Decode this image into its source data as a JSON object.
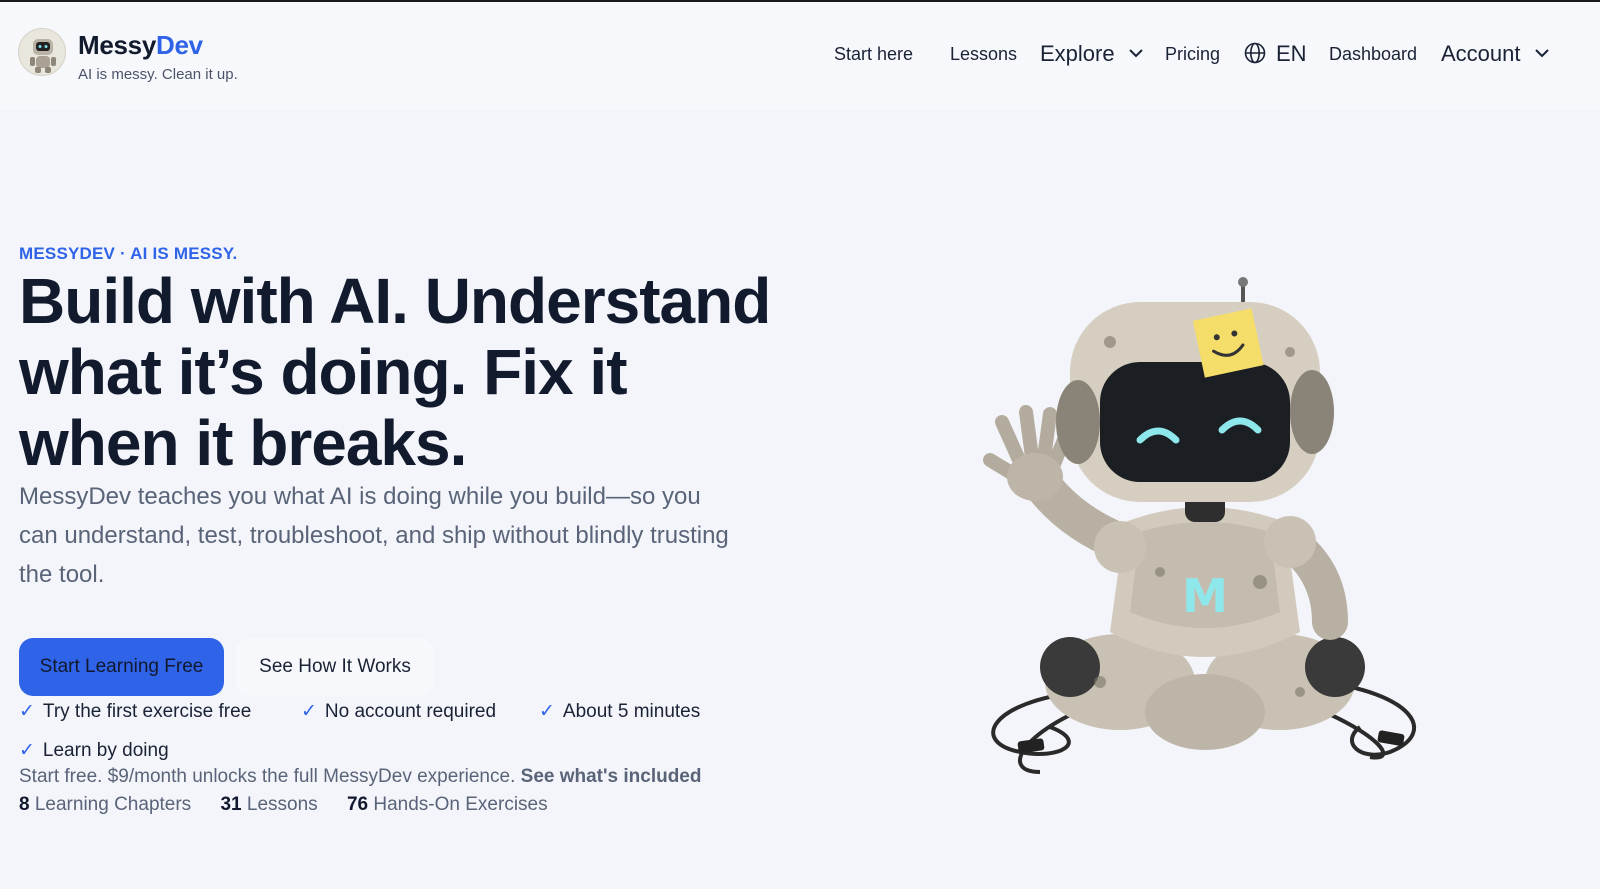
{
  "header": {
    "brand_part1": "Messy",
    "brand_part2": "Dev",
    "tagline": "AI is messy. Clean it up."
  },
  "nav": {
    "start_here": "Start here",
    "lessons": "Lessons",
    "explore": "Explore",
    "pricing": "Pricing",
    "language": "EN",
    "dashboard": "Dashboard",
    "account": "Account"
  },
  "hero": {
    "eyebrow": "MESSYDEV · AI IS MESSY.",
    "title_line1": "Build with AI. Understand",
    "title_line2": "what it’s doing. Fix it",
    "title_line3": "when it breaks.",
    "lead": "MessyDev teaches you what AI is doing while you build—so you can understand, test, troubleshoot, and ship without blindly trusting the tool.",
    "cta_primary": "Start Learning Free",
    "cta_secondary": "See How It Works"
  },
  "checks": [
    "Try the first exercise free",
    "No account required",
    "About 5 minutes",
    "Learn by doing"
  ],
  "pricing_note": {
    "text": "Start free. $9/month unlocks the full MessyDev experience.",
    "link": "See what's included"
  },
  "stats": [
    {
      "value": "8",
      "label": "Learning Chapters"
    },
    {
      "value": "31",
      "label": "Lessons"
    },
    {
      "value": "76",
      "label": "Hands-On Exercises"
    }
  ],
  "robot_chest_letter": "M",
  "colors": {
    "accent": "#2f63e8",
    "text": "#12192e",
    "muted": "#5a6478",
    "background": "#f3f5fa"
  }
}
